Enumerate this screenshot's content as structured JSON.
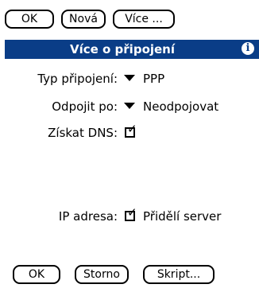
{
  "top_buttons": {
    "ok": "OK",
    "nova": "Nová",
    "vice": "Více ..."
  },
  "form": {
    "title": "Více o připojení",
    "info_icon": "i",
    "connection_type": {
      "label": "Typ připojení:",
      "value": "PPP"
    },
    "disconnect": {
      "label": "Odpojit po:",
      "value": "Neodpojovat"
    },
    "dns": {
      "label": "Získat DNS:",
      "checked": true
    },
    "ip": {
      "label": "IP adresa:",
      "checked": true,
      "value_text": "Přidělí server"
    }
  },
  "bottom_buttons": {
    "ok": "OK",
    "storno": "Storno",
    "script": "Skript..."
  },
  "colors": {
    "title_bar": "#0a3d87"
  }
}
